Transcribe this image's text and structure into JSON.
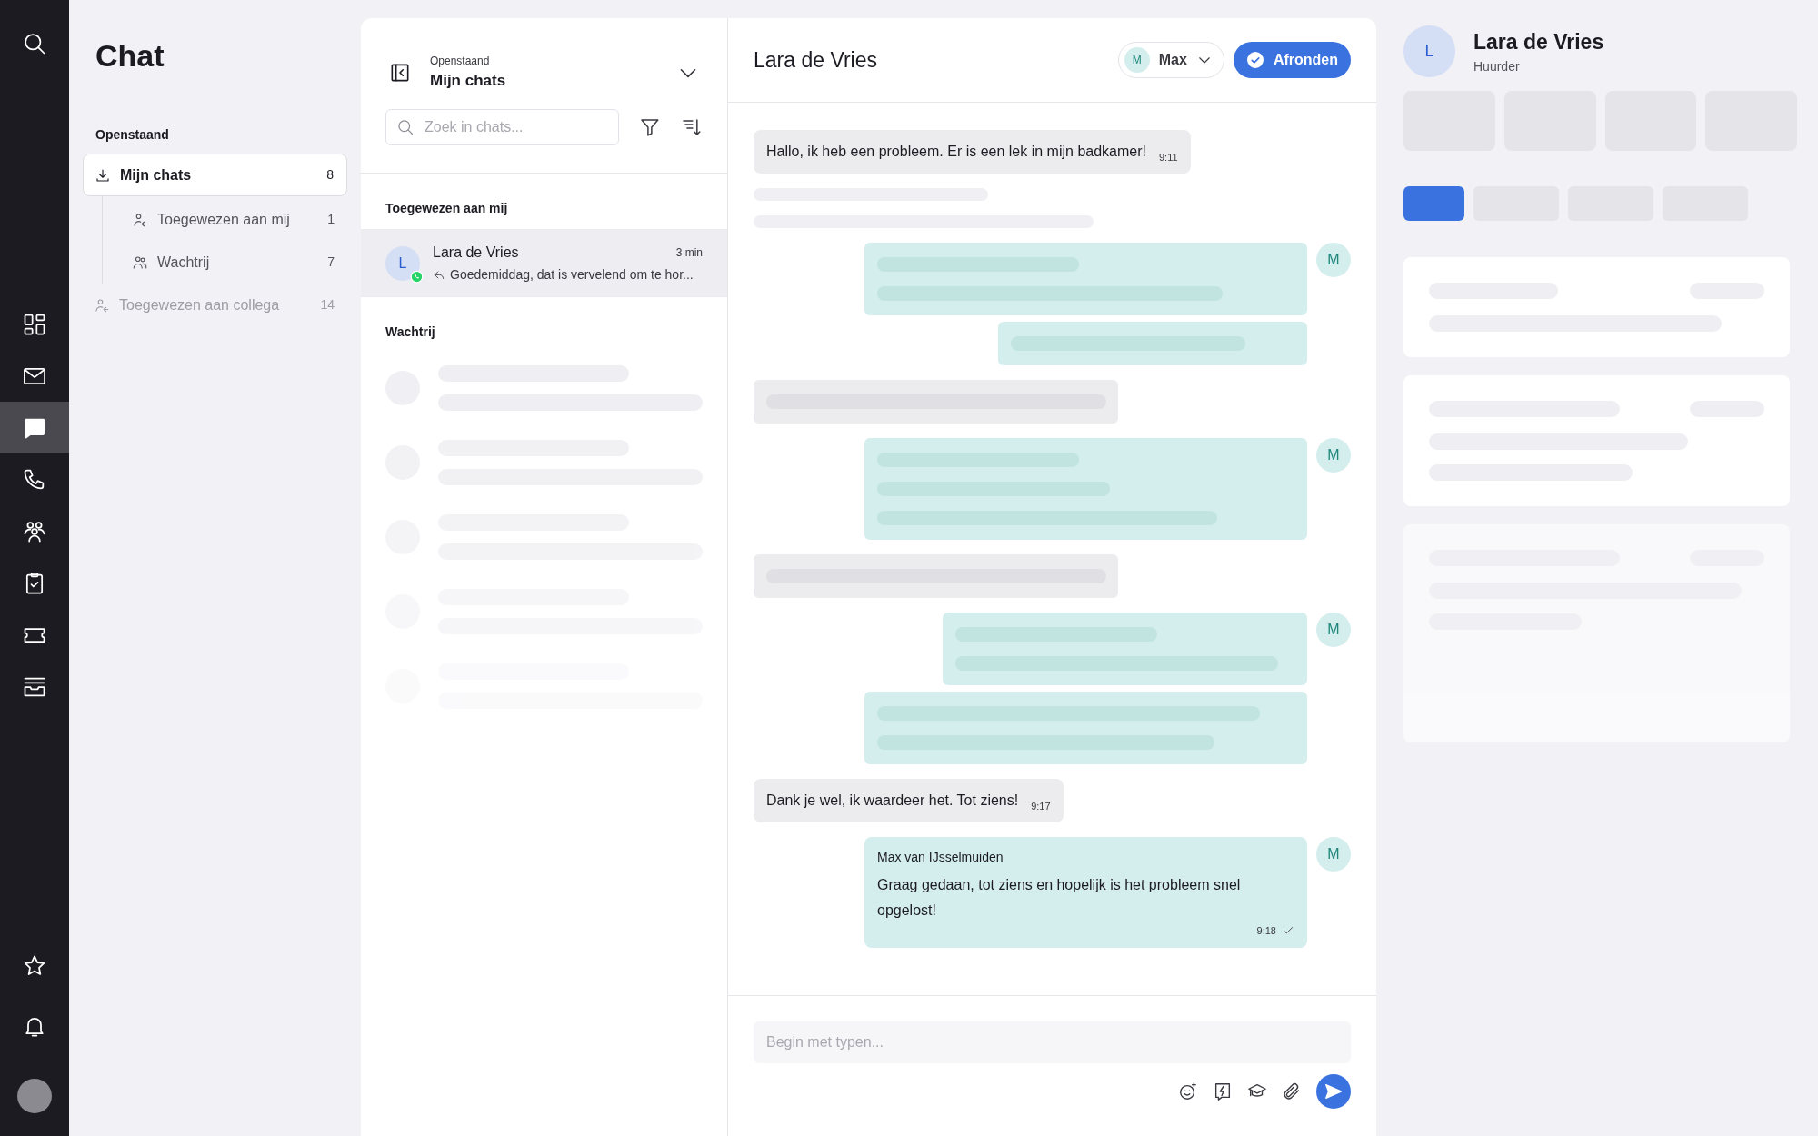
{
  "rail": {
    "items": [
      {
        "selected": false
      },
      {
        "selected": false
      },
      {
        "selected": true
      },
      {
        "selected": false
      },
      {
        "selected": false
      },
      {
        "selected": false
      },
      {
        "selected": false
      },
      {
        "selected": false
      }
    ]
  },
  "nav": {
    "title": "Chat",
    "section": "Openstaand",
    "items": [
      {
        "label": "Mijn chats",
        "count": "8",
        "selected": true,
        "disabled": false,
        "children": [
          {
            "label": "Toegewezen aan mij",
            "count": "1",
            "selected": false,
            "disabled": false
          },
          {
            "label": "Wachtrij",
            "count": "7",
            "selected": false,
            "disabled": false
          }
        ]
      },
      {
        "label": "Toegewezen aan collega",
        "count": "14",
        "selected": false,
        "disabled": true
      }
    ]
  },
  "chat_list": {
    "subtitle": "Openstaand",
    "title": "Mijn chats",
    "search": {
      "placeholder": "Zoek in chats..."
    },
    "groups": [
      {
        "title": "Toegewezen aan mij",
        "chats": [
          {
            "avatar": "L",
            "name": "Lara de Vries",
            "time": "3 min",
            "preview": "Goedemiddag, dat is vervelend om te hor...",
            "selected": true
          }
        ]
      },
      {
        "title": "Wachtrij"
      }
    ]
  },
  "conversation": {
    "title": "Lara de Vries",
    "assignee": {
      "avatar": "M",
      "name": "Max"
    },
    "finish_button": "Afronden",
    "messages": [
      {
        "kind": "customer_text",
        "text": "Hallo, ik heb een probleem. Er is een lek in mijn badkamer!",
        "time": "9:11"
      },
      {
        "kind": "customer_skeleton"
      },
      {
        "kind": "agent_skeleton",
        "avatar": "M"
      },
      {
        "kind": "customer_skeleton"
      },
      {
        "kind": "agent_skeleton",
        "avatar": "M"
      },
      {
        "kind": "customer_skeleton"
      },
      {
        "kind": "agent_skeleton",
        "avatar": "M"
      },
      {
        "kind": "customer_text",
        "text": "Dank je wel, ik waardeer het. Tot ziens!",
        "time": "9:17"
      },
      {
        "kind": "agent_text",
        "avatar": "M",
        "sender": "Max van IJsselmuiden",
        "text": "Graag gedaan, tot ziens en hopelijk is het probleem snel opgelost!",
        "time": "9:18",
        "delivered": true
      }
    ],
    "composer": {
      "placeholder": "Begin met typen..."
    }
  },
  "contact": {
    "avatar": "L",
    "name": "Lara de Vries",
    "role": "Huurder",
    "tabs": [
      {
        "selected": true
      },
      {
        "selected": false
      },
      {
        "selected": false
      },
      {
        "selected": false
      }
    ]
  }
}
